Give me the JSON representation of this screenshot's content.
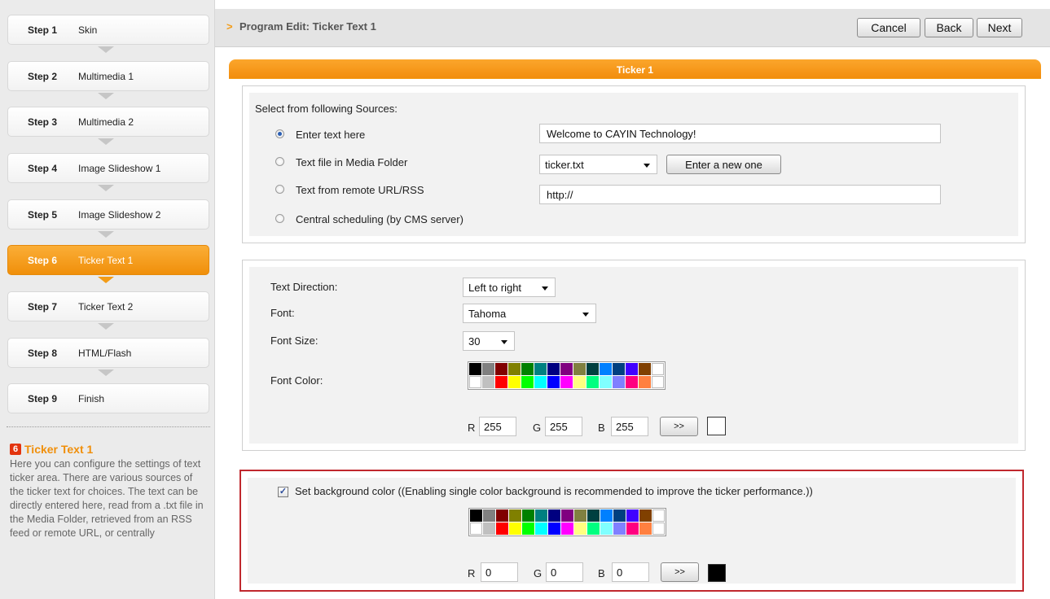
{
  "sidebar": {
    "steps": [
      {
        "num": "Step 1",
        "label": "Skin"
      },
      {
        "num": "Step 2",
        "label": "Multimedia 1"
      },
      {
        "num": "Step 3",
        "label": "Multimedia 2"
      },
      {
        "num": "Step 4",
        "label": "Image Slideshow 1"
      },
      {
        "num": "Step 5",
        "label": "Image Slideshow 2"
      },
      {
        "num": "Step 6",
        "label": "Ticker Text 1"
      },
      {
        "num": "Step 7",
        "label": "Ticker Text 2"
      },
      {
        "num": "Step 8",
        "label": "HTML/Flash"
      },
      {
        "num": "Step 9",
        "label": "Finish"
      }
    ],
    "active_step": "Step 6",
    "help": {
      "badge": "6",
      "title": "Ticker Text 1",
      "text": "Here you can configure the settings of text ticker area. There are various sources of the ticker text for choices. The text can be directly entered here, read from a .txt file in the Media Folder, retrieved from an RSS feed or remote URL, or centrally"
    }
  },
  "header": {
    "chevron": ">",
    "title": "Program Edit: Ticker Text 1",
    "cancel": "Cancel",
    "back": "Back",
    "next": "Next"
  },
  "panel": {
    "title": "Ticker 1",
    "sources": {
      "heading": "Select from following Sources:",
      "options": [
        {
          "label": "Enter text here",
          "selected": true
        },
        {
          "label": "Text file in Media Folder",
          "selected": false
        },
        {
          "label": "Text from remote URL/RSS",
          "selected": false
        },
        {
          "label": "Central scheduling (by CMS server)",
          "selected": false
        }
      ],
      "text_value": "Welcome to CAYIN Technology!",
      "file_select": "ticker.txt",
      "enter_new": "Enter a new one",
      "url_value": "http://"
    },
    "text_settings": {
      "direction_label": "Text Direction:",
      "direction_value": "Left to right",
      "font_label": "Font:",
      "font_value": "Tahoma",
      "size_label": "Font Size:",
      "size_value": "30",
      "color_label": "Font Color:",
      "r_label": "R",
      "r": "255",
      "g_label": "G",
      "g": "255",
      "b_label": "B",
      "b": "255",
      "apply": ">>",
      "preview_color": "#ffffff"
    },
    "background": {
      "checked": true,
      "label": "Set background color ((Enabling single color background is recommended to improve the ticker performance.))",
      "r_label": "R",
      "r": "0",
      "g_label": "G",
      "g": "0",
      "b_label": "B",
      "b": "0",
      "apply": ">>",
      "preview_color": "#000000"
    },
    "palette": [
      "#000000",
      "#808080",
      "#800000",
      "#808000",
      "#008000",
      "#008080",
      "#000080",
      "#800080",
      "#808040",
      "#004040",
      "#0080ff",
      "#004080",
      "#4000ff",
      "#804000",
      "#ffffff",
      "#ffffff",
      "#c0c0c0",
      "#ff0000",
      "#ffff00",
      "#00ff00",
      "#00ffff",
      "#0000ff",
      "#ff00ff",
      "#ffff80",
      "#00ff80",
      "#80ffff",
      "#8080ff",
      "#ff0080",
      "#ff8040",
      "#ffffff"
    ]
  },
  "colors": {
    "accent": "#f39c17",
    "highlight_border": "#c0282e"
  }
}
